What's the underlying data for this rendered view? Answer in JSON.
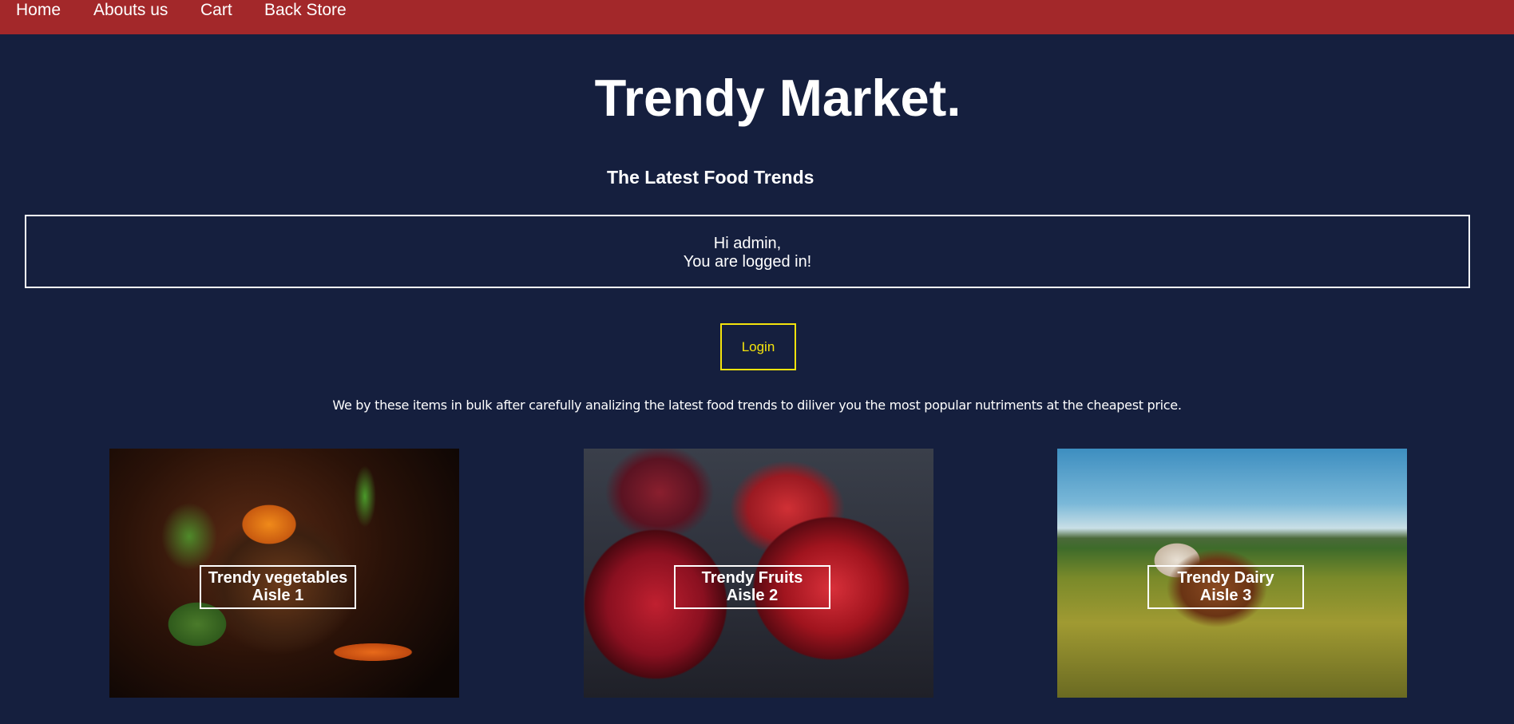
{
  "nav": {
    "items": [
      {
        "label": "Home"
      },
      {
        "label": "Abouts us"
      },
      {
        "label": "Cart"
      },
      {
        "label": "Back Store"
      }
    ],
    "color": "#a3282a"
  },
  "header": {
    "title": "Trendy Market",
    "title_suffix": ".",
    "subtitle": "The Latest Food Trends"
  },
  "welcome": {
    "line1": "Hi admin,",
    "line2": "You are logged in!"
  },
  "login_button": {
    "label": "Login",
    "color": "#f4e30c"
  },
  "intro": "We by these items in bulk after carefully analizing the latest food trends to diliver you the most popular nutriments at the cheapest price.",
  "cards": [
    {
      "title": "Trendy vegetables",
      "aisle": "Aisle 1",
      "image": "vegetable-basket-photo"
    },
    {
      "title": "Trendy Fruits",
      "aisle": "Aisle 2",
      "image": "red-apples-photo"
    },
    {
      "title": "Trendy Dairy",
      "aisle": "Aisle 3",
      "image": "cow-in-field-photo"
    }
  ],
  "colors": {
    "background": "#151f3e",
    "text": "#ffffff"
  }
}
